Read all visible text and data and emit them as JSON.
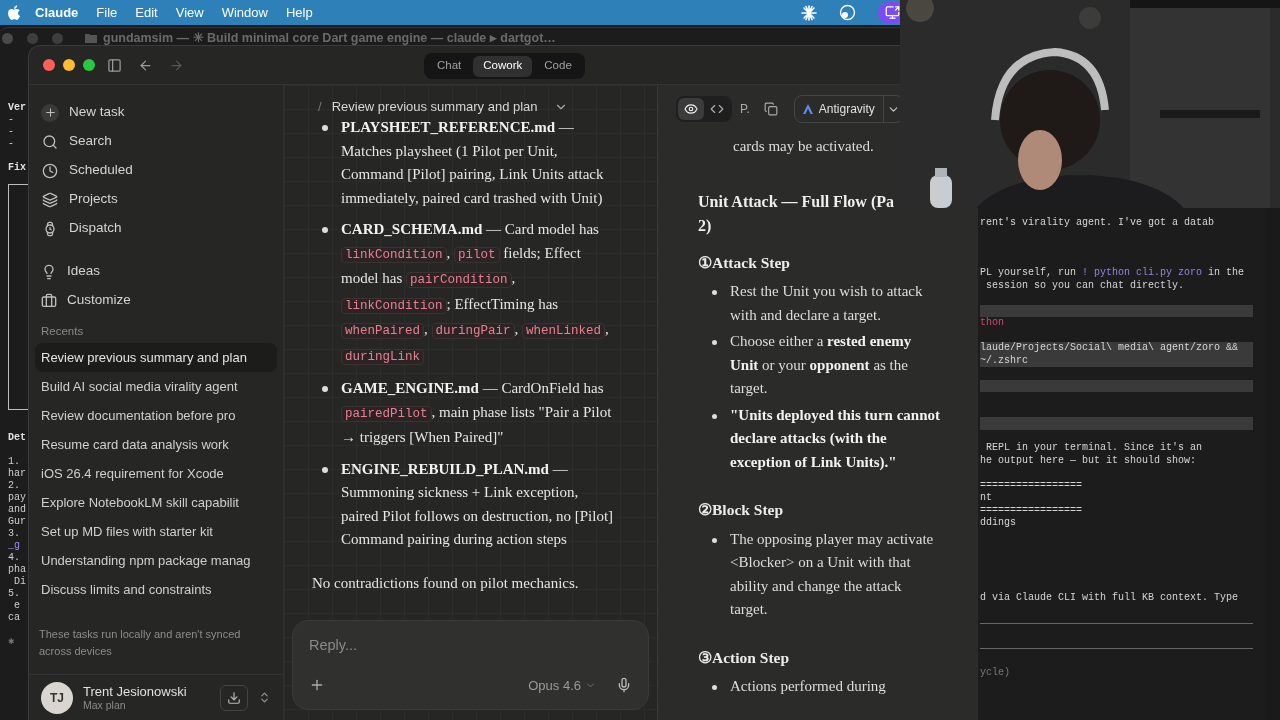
{
  "menu_bar": {
    "app": "Claude",
    "items": [
      "File",
      "Edit",
      "View",
      "Window",
      "Help"
    ]
  },
  "background_window": {
    "title": "gundamsim — ✳ Build minimal core Dart game engine — claude ▸ dartgot…",
    "lines": [
      {
        "kind": "bold",
        "text": "Ver"
      },
      {
        "kind": "text",
        "text": "-"
      },
      {
        "kind": "text",
        "text": "-"
      },
      {
        "kind": "text",
        "text": "-"
      },
      {
        "kind": "gap"
      },
      {
        "kind": "bold",
        "text": "Fix"
      },
      {
        "kind": "box"
      },
      {
        "kind": "gap"
      },
      {
        "kind": "bold",
        "text": "Det"
      },
      {
        "kind": "gap"
      },
      {
        "kind": "text",
        "text": "1."
      },
      {
        "kind": "text",
        "text": "har"
      },
      {
        "kind": "text",
        "text": "2."
      },
      {
        "kind": "text",
        "text": "pay"
      },
      {
        "kind": "text",
        "text": "and"
      },
      {
        "kind": "text",
        "text": "Gur"
      },
      {
        "kind": "text",
        "text": "3."
      },
      {
        "kind": "accent",
        "text": "_g"
      },
      {
        "kind": "text",
        "text": "4."
      },
      {
        "kind": "text",
        "text": "pha"
      },
      {
        "kind": "text",
        "text": " Di"
      },
      {
        "kind": "text",
        "text": "5."
      },
      {
        "kind": "text",
        "text": " e"
      },
      {
        "kind": "text",
        "text": "ca"
      },
      {
        "kind": "gap"
      },
      {
        "kind": "dim",
        "text": "✱"
      }
    ]
  },
  "terminal": {
    "lines": [
      {
        "kind": "text",
        "segments": [
          {
            "kind": "text",
            "text": "rent's virality agent. I've got a datab"
          }
        ]
      },
      {
        "kind": "gap"
      },
      {
        "kind": "gap"
      },
      {
        "kind": "gap"
      },
      {
        "kind": "text",
        "segments": [
          {
            "kind": "text",
            "text": "PL yourself, run "
          },
          {
            "kind": "accent",
            "text": "! python cli.py zoro"
          },
          {
            "kind": "text",
            "text": " in the"
          }
        ]
      },
      {
        "kind": "text",
        "segments": [
          {
            "kind": "text",
            "text": " session so you can chat directly."
          }
        ]
      },
      {
        "kind": "gap"
      },
      {
        "kind": "bar"
      },
      {
        "kind": "text",
        "segments": [
          {
            "kind": "pink",
            "text": "thon"
          }
        ]
      },
      {
        "kind": "gap"
      },
      {
        "kind": "shaded",
        "segments": [
          {
            "kind": "text",
            "text": "laude/Projects/Social\\ media\\ agent/zoro &&"
          }
        ]
      },
      {
        "kind": "shaded",
        "segments": [
          {
            "kind": "text",
            "text": "~/.zshrc"
          }
        ]
      },
      {
        "kind": "gap"
      },
      {
        "kind": "bar"
      },
      {
        "kind": "gap"
      },
      {
        "kind": "gap"
      },
      {
        "kind": "bar"
      },
      {
        "kind": "gap"
      },
      {
        "kind": "text",
        "segments": [
          {
            "kind": "text",
            "text": " REPL in your terminal. Since it's an"
          }
        ]
      },
      {
        "kind": "text",
        "segments": [
          {
            "kind": "text",
            "text": "he output here — but it should show:"
          }
        ]
      },
      {
        "kind": "gap"
      },
      {
        "kind": "text",
        "segments": [
          {
            "kind": "text",
            "text": "================="
          }
        ]
      },
      {
        "kind": "text",
        "segments": [
          {
            "kind": "text",
            "text": "nt"
          }
        ]
      },
      {
        "kind": "text",
        "segments": [
          {
            "kind": "text",
            "text": "================="
          }
        ]
      },
      {
        "kind": "text",
        "segments": [
          {
            "kind": "text",
            "text": "ddings"
          }
        ]
      },
      {
        "kind": "gap"
      },
      {
        "kind": "gap"
      },
      {
        "kind": "gap"
      },
      {
        "kind": "gap"
      },
      {
        "kind": "gap"
      },
      {
        "kind": "text",
        "segments": [
          {
            "kind": "text",
            "text": "d via Claude CLI with full KB context. Type"
          }
        ]
      },
      {
        "kind": "gap"
      },
      {
        "kind": "rule"
      },
      {
        "kind": "gap"
      },
      {
        "kind": "rule"
      },
      {
        "kind": "gap"
      },
      {
        "kind": "text",
        "segments": [
          {
            "kind": "dim",
            "text": "ycle)"
          }
        ]
      }
    ]
  },
  "window": {
    "mode_tabs": [
      {
        "label": "Chat",
        "selected": false
      },
      {
        "label": "Cowork",
        "selected": true
      },
      {
        "label": "Code",
        "selected": false
      }
    ],
    "sidebar": {
      "nav": [
        {
          "label": "New task"
        },
        {
          "label": "Search"
        },
        {
          "label": "Scheduled"
        },
        {
          "label": "Projects"
        },
        {
          "label": "Dispatch"
        }
      ],
      "nav_2": [
        {
          "label": "Ideas"
        },
        {
          "label": "Customize"
        }
      ],
      "recents_label": "Recents",
      "recents": [
        {
          "label": "Review previous summary and plan",
          "selected": true
        },
        {
          "label": "Build AI social media virality agent",
          "selected": false
        },
        {
          "label": "Review documentation before pro",
          "selected": false
        },
        {
          "label": "Resume card data analysis work",
          "selected": false
        },
        {
          "label": "iOS 26.4 requirement for Xcode",
          "selected": false
        },
        {
          "label": "Explore NotebookLM skill capabilit",
          "selected": false
        },
        {
          "label": "Set up MD files with starter kit",
          "selected": false
        },
        {
          "label": "Understanding npm package manag",
          "selected": false
        },
        {
          "label": "Discuss limits and constraints",
          "selected": false
        }
      ],
      "note": "These tasks run locally and aren't synced across devices",
      "user": {
        "initials": "TJ",
        "name": "Trent Jesionowski",
        "plan": "Max plan"
      }
    },
    "chat": {
      "breadcrumb_separator": "/",
      "title": "Review previous summary and plan",
      "bullets": [
        [
          {
            "kind": "bold",
            "text": "PLAYSHEET_REFERENCE.md"
          },
          {
            "kind": "text",
            "text": " — Matches playsheet (1 Pilot per Unit, Command [Pilot] pairing, Link Units attack immediately, paired card trashed with Unit)"
          }
        ],
        [
          {
            "kind": "bold",
            "text": "CARD_SCHEMA.md"
          },
          {
            "kind": "text",
            "text": " — Card model has "
          },
          {
            "kind": "code",
            "text": "linkCondition"
          },
          {
            "kind": "text",
            "text": ", "
          },
          {
            "kind": "code",
            "text": "pilot"
          },
          {
            "kind": "text",
            "text": " fields; Effect model has "
          },
          {
            "kind": "code",
            "text": "pairCondition"
          },
          {
            "kind": "text",
            "text": ", "
          },
          {
            "kind": "code",
            "text": "linkCondition"
          },
          {
            "kind": "text",
            "text": "; EffectTiming has "
          },
          {
            "kind": "code",
            "text": "whenPaired"
          },
          {
            "kind": "text",
            "text": ", "
          },
          {
            "kind": "code",
            "text": "duringPair"
          },
          {
            "kind": "text",
            "text": ", "
          },
          {
            "kind": "code",
            "text": "whenLinked"
          },
          {
            "kind": "text",
            "text": ", "
          },
          {
            "kind": "code",
            "text": "duringLink"
          }
        ],
        [
          {
            "kind": "bold",
            "text": "GAME_ENGINE.md"
          },
          {
            "kind": "text",
            "text": " — CardOnField has "
          },
          {
            "kind": "code",
            "text": "pairedPilot"
          },
          {
            "kind": "text",
            "text": ", main phase lists \"Pair a Pilot → triggers [When Paired]\""
          }
        ],
        [
          {
            "kind": "bold",
            "text": "ENGINE_REBUILD_PLAN.md"
          },
          {
            "kind": "text",
            "text": " — Summoning sickness + Link exception, paired Pilot follows on destruction, no [Pilot] Command pairing during action steps"
          }
        ]
      ],
      "paragraph": "No contradictions found on pilot mechanics.",
      "composer": {
        "placeholder": "Reply...",
        "model": "Opus 4.6"
      }
    },
    "artifact": {
      "view_toggle": [
        {
          "kind": "preview",
          "selected": true
        },
        {
          "kind": "code",
          "selected": false
        }
      ],
      "label": "P.",
      "open_in": "Antigravity",
      "lead": "cards may be activated.",
      "heading": [
        "Unit Attack — Full Flow (Pa",
        "2)"
      ],
      "sections": [
        {
          "title": "①Attack Step",
          "bullets": [
            [
              {
                "kind": "text",
                "text": "Rest the Unit you wish to attack with and declare a target."
              }
            ],
            [
              {
                "kind": "text",
                "text": "Choose either a "
              },
              {
                "kind": "bold",
                "text": "rested enemy Unit"
              },
              {
                "kind": "text",
                "text": " or your "
              },
              {
                "kind": "bold",
                "text": "opponent"
              },
              {
                "kind": "text",
                "text": " as the target."
              }
            ],
            [
              {
                "kind": "bold",
                "text": "\"Units deployed this turn cannot declare attacks (with the exception of Link Units).\""
              }
            ]
          ]
        },
        {
          "title": "②Block Step",
          "bullets": [
            [
              {
                "kind": "text",
                "text": "The opposing player may activate <Blocker> on a Unit with that ability and change the attack target."
              }
            ]
          ]
        },
        {
          "title": "③Action Step",
          "bullets": [
            [
              {
                "kind": "text",
                "text": "Actions performed during"
              }
            ]
          ]
        }
      ]
    }
  }
}
